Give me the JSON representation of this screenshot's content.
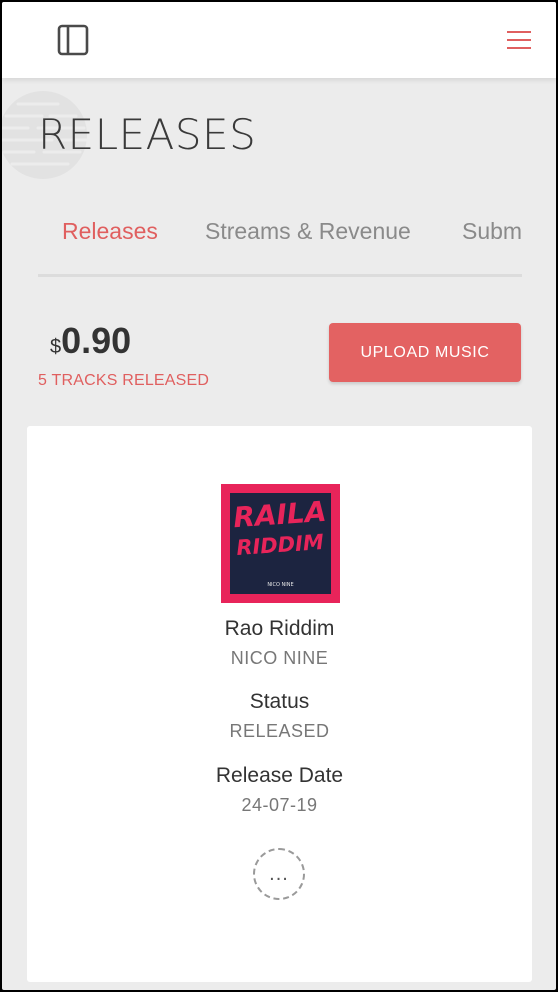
{
  "header": {
    "sidebar_icon": "sidebar-panel-icon",
    "menu_icon": "hamburger-menu-icon",
    "background_logo": "globe-logo"
  },
  "page": {
    "title": "RELEASES"
  },
  "tabs": [
    {
      "label": "Releases",
      "active": true
    },
    {
      "label": "Streams & Revenue",
      "active": false
    },
    {
      "label": "Submissions",
      "active": false
    }
  ],
  "summary": {
    "currency_symbol": "$",
    "amount": "0.90",
    "tracks_count": "5",
    "tracks_label": "TRACKS RELEASED"
  },
  "actions": {
    "upload_label": "UPLOAD MUSIC"
  },
  "release": {
    "cover": {
      "line1": "RAILA",
      "line2": "RIDDIM",
      "artist": "NICO NINE",
      "bg_color": "#e8245a",
      "panel_color": "#1c2440"
    },
    "title": "Rao Riddim",
    "artist": "NICO NINE",
    "status_label": "Status",
    "status_value": "RELEASED",
    "date_label": "Release Date",
    "date_value": "24-07-19",
    "more_label": "..."
  },
  "colors": {
    "accent": "#e05f5f",
    "button": "#e36262",
    "page_bg": "#ececec"
  }
}
